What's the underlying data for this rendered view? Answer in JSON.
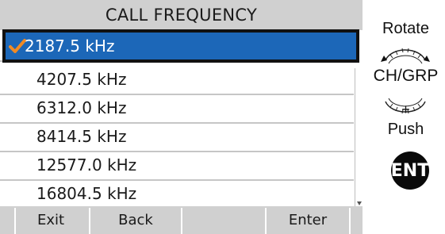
{
  "screen": {
    "title": "CALL FREQUENCY",
    "frequencies": [
      {
        "label": "2187.5 kHz",
        "selected": true,
        "checked": true
      },
      {
        "label": "4207.5 kHz",
        "selected": false
      },
      {
        "label": "6312.0 kHz",
        "selected": false
      },
      {
        "label": "8414.5 kHz",
        "selected": false
      },
      {
        "label": "12577.0 kHz",
        "selected": false
      },
      {
        "label": "16804.5 kHz",
        "selected": false
      }
    ],
    "softkeys": [
      "Exit",
      "Back",
      "",
      "Enter"
    ]
  },
  "instructions": {
    "rotate": "Rotate",
    "dial": "CH/GRP",
    "plus": "+",
    "push": "Push",
    "key": "ENT"
  },
  "colors": {
    "highlight": "#1c67b8",
    "check": "#f08a24",
    "bar": "#d0d0d0"
  }
}
